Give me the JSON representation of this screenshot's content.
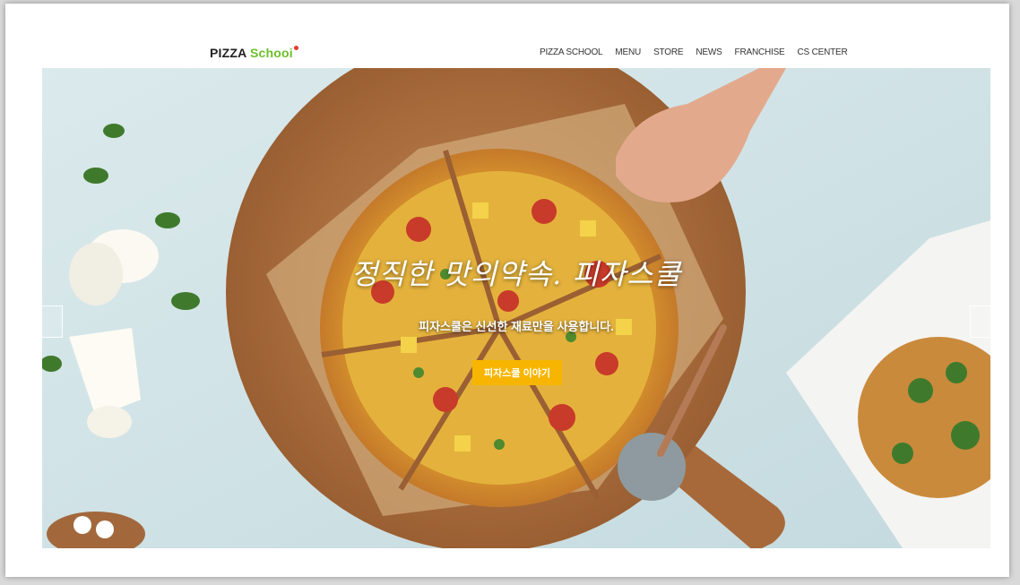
{
  "header": {
    "logo_pizza": "PIZZA",
    "logo_school": "Schooi",
    "nav": [
      "PIZZA SCHOOL",
      "MENU",
      "STORE",
      "NEWS",
      "FRANCHISE",
      "CS CENTER"
    ]
  },
  "hero": {
    "title": "정직한 맛의약속. 피자스쿨",
    "subtitle": "피자스쿨은 신선한 재료만을 사용합니다.",
    "button_label": "피자스쿨 이야기"
  },
  "colors": {
    "accent_button": "#f7b500",
    "logo_green": "#6cbf2a"
  }
}
